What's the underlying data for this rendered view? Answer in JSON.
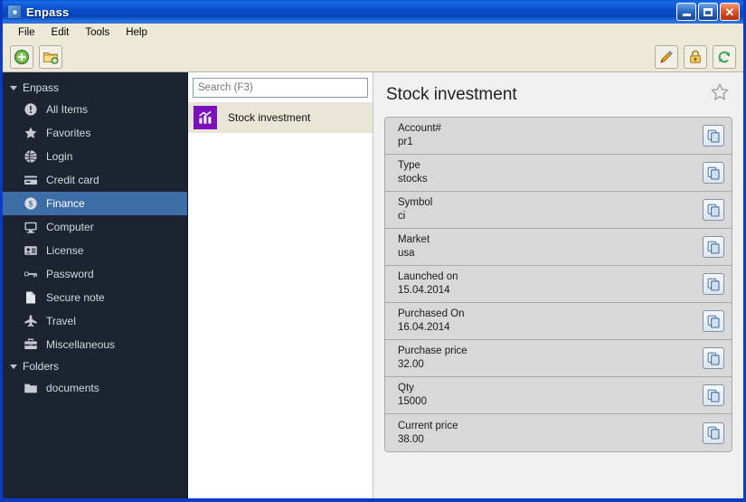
{
  "window": {
    "title": "Enpass",
    "app_icon": "app-icon",
    "controls": {
      "minimize": "minimize",
      "maximize": "maximize",
      "close": "close"
    }
  },
  "menubar": {
    "items": [
      {
        "label": "File"
      },
      {
        "label": "Edit"
      },
      {
        "label": "Tools"
      },
      {
        "label": "Help"
      }
    ]
  },
  "toolbar": {
    "left": [
      {
        "name": "add-item-button",
        "icon": "plus-circle-icon",
        "label": ""
      },
      {
        "name": "add-folder-button",
        "icon": "folder-add-icon",
        "label": ""
      }
    ],
    "right": [
      {
        "name": "edit-button",
        "icon": "pencil-icon",
        "label": ""
      },
      {
        "name": "lock-button",
        "icon": "lock-icon",
        "label": ""
      },
      {
        "name": "sync-button",
        "icon": "sync-icon",
        "label": ""
      }
    ]
  },
  "sidebar": {
    "groups": [
      {
        "label": "Enpass",
        "items": [
          {
            "label": "All Items",
            "icon": "info-circle-icon",
            "selected": false
          },
          {
            "label": "Favorites",
            "icon": "star-icon",
            "selected": false
          },
          {
            "label": "Login",
            "icon": "globe-icon",
            "selected": false
          },
          {
            "label": "Credit card",
            "icon": "credit-card-icon",
            "selected": false
          },
          {
            "label": "Finance",
            "icon": "dollar-circle-icon",
            "selected": true
          },
          {
            "label": "Computer",
            "icon": "monitor-icon",
            "selected": false
          },
          {
            "label": "License",
            "icon": "id-card-icon",
            "selected": false
          },
          {
            "label": "Password",
            "icon": "key-icon",
            "selected": false
          },
          {
            "label": "Secure note",
            "icon": "note-icon",
            "selected": false
          },
          {
            "label": "Travel",
            "icon": "airplane-icon",
            "selected": false
          },
          {
            "label": "Miscellaneous",
            "icon": "briefcase-icon",
            "selected": false
          }
        ]
      },
      {
        "label": "Folders",
        "items": [
          {
            "label": "documents",
            "icon": "folder-icon",
            "selected": false
          }
        ]
      }
    ]
  },
  "list": {
    "search": {
      "value": "",
      "placeholder": "Search (F3)"
    },
    "items": [
      {
        "label": "Stock investment",
        "icon": "chart-icon",
        "icon_color": "#7b11bd",
        "selected": true
      }
    ]
  },
  "detail": {
    "title": "Stock investment",
    "favorite_icon": "star-outline-icon",
    "favorite": false,
    "copy_icon": "copy-icon",
    "fields": [
      {
        "label": "Account#",
        "value": "pr1"
      },
      {
        "label": "Type",
        "value": "stocks"
      },
      {
        "label": "Symbol",
        "value": "ci"
      },
      {
        "label": "Market",
        "value": "usa"
      },
      {
        "label": "Launched on",
        "value": "15.04.2014"
      },
      {
        "label": "Purchased On",
        "value": "16.04.2014"
      },
      {
        "label": "Purchase price",
        "value": "32.00"
      },
      {
        "label": "Qty",
        "value": "15000"
      },
      {
        "label": "Current price",
        "value": "38.00"
      }
    ]
  },
  "colors": {
    "titlebar_blue": "#0b4fc8",
    "window_border": "#0a3bc4",
    "sidebar_bg": "#1b2430",
    "sidebar_selected": "#3c6ea5",
    "list_selected": "#e9e5d7",
    "item_icon_purple": "#7b11bd",
    "field_bg": "#d8d8d8",
    "detail_bg": "#f0f0f0",
    "chrome_beige": "#ece9d8"
  }
}
